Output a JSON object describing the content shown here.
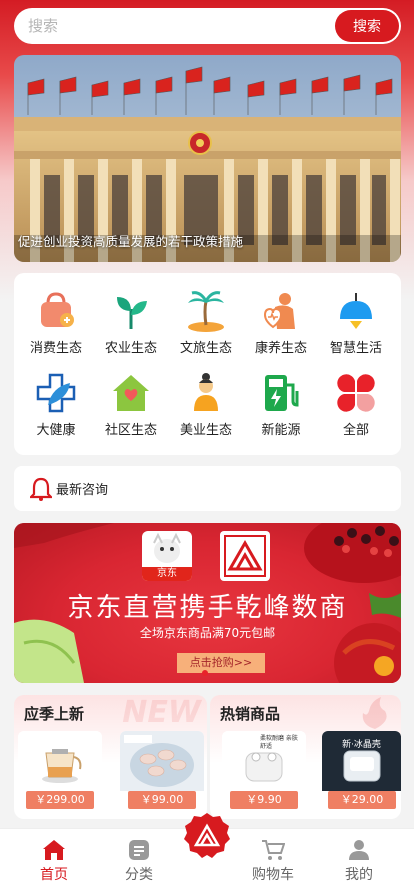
{
  "search": {
    "placeholder": "搜索",
    "button_label": "搜索"
  },
  "banner": {
    "caption": "促进创业投资高质量发展的若干政策措施"
  },
  "categories": [
    {
      "label": "消费生态",
      "icon": "shopping-bag-icon"
    },
    {
      "label": "农业生态",
      "icon": "sprout-icon"
    },
    {
      "label": "文旅生态",
      "icon": "palm-island-icon"
    },
    {
      "label": "康养生态",
      "icon": "caregiver-icon"
    },
    {
      "label": "智慧生活",
      "icon": "lamp-icon"
    },
    {
      "label": "大健康",
      "icon": "medical-cross-icon"
    },
    {
      "label": "社区生态",
      "icon": "house-icon"
    },
    {
      "label": "美业生态",
      "icon": "beauty-woman-icon"
    },
    {
      "label": "新能源",
      "icon": "charging-station-icon"
    },
    {
      "label": "全部",
      "icon": "four-petals-icon"
    }
  ],
  "news": {
    "label": "最新咨询",
    "icon": "bell-icon"
  },
  "promo": {
    "jd_logo_text": "京东",
    "title": "京东直营携手乾峰数商",
    "subtitle": "全场京东商品满70元包邮",
    "button": "点击抢购>>"
  },
  "sections": {
    "seasonal": {
      "title": "应季上新",
      "watermark": "NEW",
      "products": [
        {
          "price": "￥299.00",
          "image": "health-kettle"
        },
        {
          "price": "￥99.00",
          "image": "frozen-shrimp"
        }
      ]
    },
    "hot": {
      "title": "热销商品",
      "products": [
        {
          "price": "￥9.90",
          "image": "earbuds-case",
          "tag": "柔软耐磨 亲肤舒适"
        },
        {
          "price": "￥29.00",
          "image": "clear-case",
          "tag": "新·冰晶壳"
        }
      ]
    }
  },
  "tabs": [
    {
      "label": "首页",
      "icon": "home-icon",
      "active": true
    },
    {
      "label": "分类",
      "icon": "category-icon",
      "active": false
    },
    {
      "label": "购物车",
      "icon": "cart-icon",
      "active": false
    },
    {
      "label": "我的",
      "icon": "user-icon",
      "active": false
    }
  ],
  "colors": {
    "brand_red": "#d71a1f",
    "price_orange": "#ef7f63",
    "promo_red": "#d92632"
  }
}
